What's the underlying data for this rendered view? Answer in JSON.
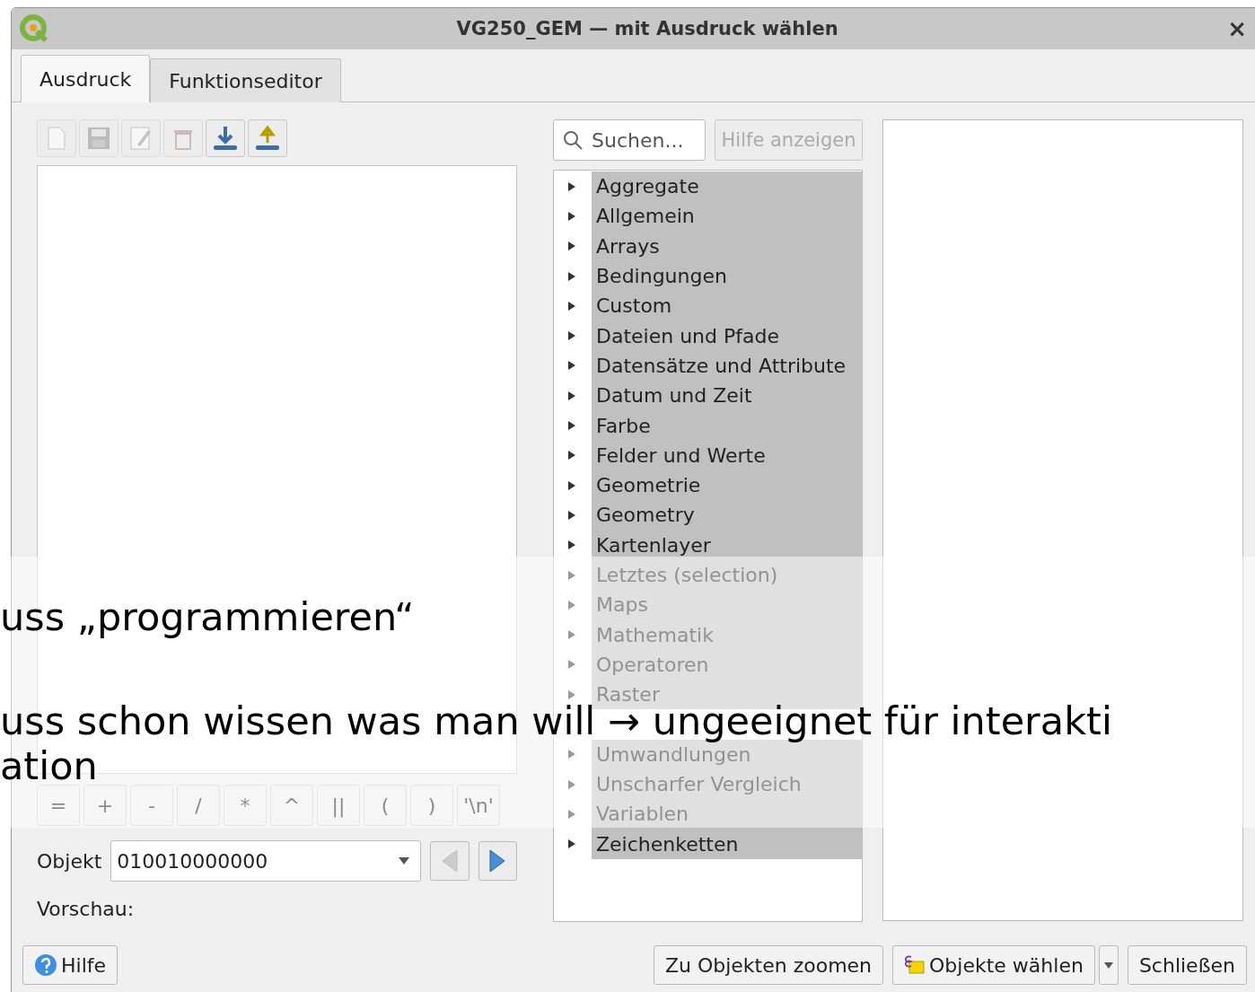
{
  "window": {
    "title": "VG250_GEM — mit Ausdruck wählen",
    "close": "×"
  },
  "tabs": [
    {
      "label": "Ausdruck",
      "selected": true
    },
    {
      "label": "Funktionseditor",
      "selected": false
    }
  ],
  "toolbar": [
    {
      "kind": "new",
      "disabled": true
    },
    {
      "kind": "save",
      "disabled": true
    },
    {
      "kind": "edit",
      "disabled": true
    },
    {
      "kind": "delete",
      "disabled": true
    },
    {
      "kind": "import",
      "disabled": false
    },
    {
      "kind": "export",
      "disabled": false
    }
  ],
  "search": {
    "placeholder": "Suchen..."
  },
  "help_button": {
    "label": "Hilfe anzeigen",
    "disabled": true
  },
  "function_groups": [
    {
      "label": "Aggregate"
    },
    {
      "label": "Allgemein"
    },
    {
      "label": "Arrays"
    },
    {
      "label": "Bedingungen"
    },
    {
      "label": "Custom"
    },
    {
      "label": "Dateien und Pfade"
    },
    {
      "label": "Datensätze und Attribute"
    },
    {
      "label": "Datum und Zeit"
    },
    {
      "label": "Farbe"
    },
    {
      "label": "Felder und Werte"
    },
    {
      "label": "Geometrie"
    },
    {
      "label": "Geometry"
    },
    {
      "label": "Kartenlayer"
    },
    {
      "label": "Letztes (selection)"
    },
    {
      "label": "Maps"
    },
    {
      "label": "Mathematik"
    },
    {
      "label": "Operatoren"
    },
    {
      "label": "Raster"
    },
    {
      "kind": "covered"
    },
    {
      "label": "Umwandlungen"
    },
    {
      "label": "Unscharfer Vergleich"
    },
    {
      "label": "Variablen"
    },
    {
      "label": "Zeichenketten"
    }
  ],
  "operators": [
    "=",
    "+",
    "-",
    "/",
    "*",
    "^",
    "||",
    "(",
    ")",
    "'\\n'"
  ],
  "object": {
    "label": "Objekt",
    "value": "010010000000"
  },
  "preview": {
    "label": "Vorschau:"
  },
  "buttons": {
    "help": "Hilfe",
    "zoom": "Zu Objekten zoomen",
    "select": "Objekte wählen",
    "close": "Schließen"
  },
  "overlay": {
    "lines": [
      "uss „programmieren“",
      "uss schon wissen was man will → ungeeignet für interakti",
      "ation"
    ]
  }
}
